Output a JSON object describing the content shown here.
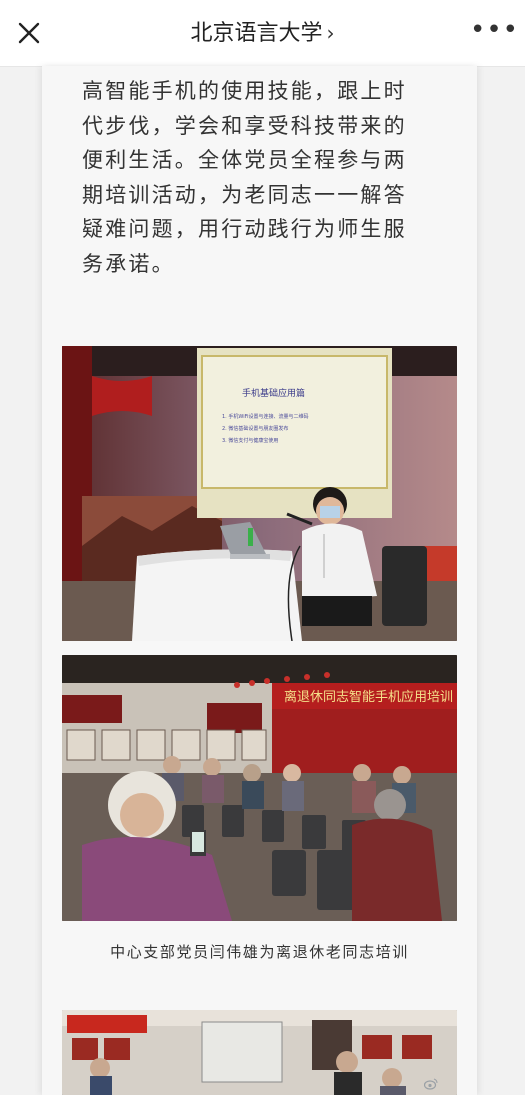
{
  "header": {
    "title": "北京语言大学",
    "chevron": "›",
    "more": "•••"
  },
  "article": {
    "paragraph_lines": [
      "高智能手机的使用技能，跟上时",
      "代步伐，学会和享受科技带来的",
      "便利生活。全体党员全程参与两",
      "期培训活动，为老同志一一解答",
      "疑难问题，用行动践行为师生服",
      "务承诺。"
    ],
    "photo1": {
      "slide_title": "手机基础应用篇",
      "slide_lines": [
        "1. 手机WiFi设置与连接、流量与二维码",
        "2. 微信基础设置与朋友圈发布",
        "3. 微信支付与健康宝使用"
      ]
    },
    "photo2": {
      "banner": "离退休同志智能手机应用培训"
    },
    "caption": "中心支部党员闫伟雄为离退休老同志培训"
  },
  "colors": {
    "accent": "#d83a2e",
    "page_bg": "#f2f2f2",
    "article_bg": "#f7f7f7"
  },
  "icons": {
    "close": "close-icon",
    "more": "more-icon",
    "chevron": "chevron-right-icon"
  }
}
